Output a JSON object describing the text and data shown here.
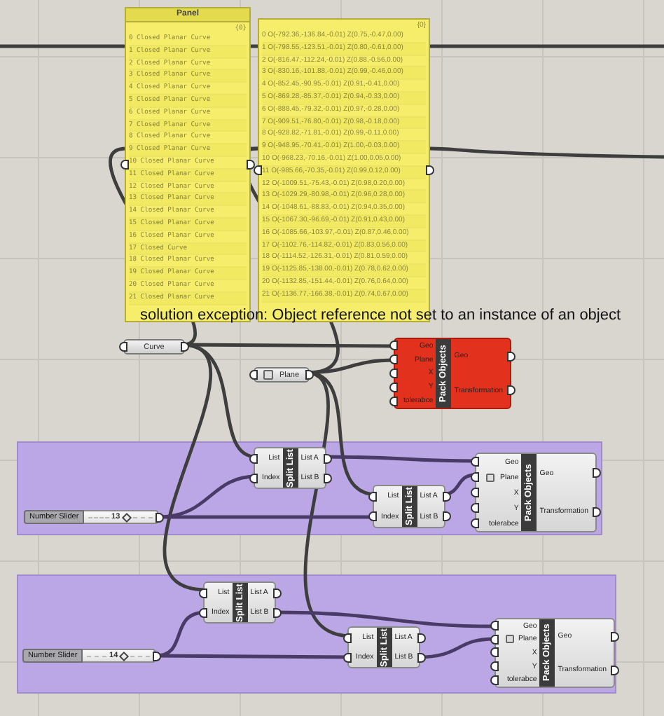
{
  "panels": [
    {
      "title": "Panel",
      "path": "{0}",
      "items": [
        "0 Closed Planar Curve",
        "1 Closed Planar Curve",
        "2 Closed Planar Curve",
        "3 Closed Planar Curve",
        "4 Closed Planar Curve",
        "5 Closed Planar Curve",
        "6 Closed Planar Curve",
        "7 Closed Planar Curve",
        "8 Closed Planar Curve",
        "9 Closed Planar Curve",
        "10 Closed Planar Curve",
        "11 Closed Planar Curve",
        "12 Closed Planar Curve",
        "13 Closed Planar Curve",
        "14 Closed Planar Curve",
        "15 Closed Planar Curve",
        "16 Closed Planar Curve",
        "17 Closed Curve",
        "18 Closed Planar Curve",
        "19 Closed Planar Curve",
        "20 Closed Planar Curve",
        "21 Closed Planar Curve"
      ]
    },
    {
      "path": "{0}",
      "items": [
        "0 O(-792.36,-136.84,-0.01) Z(0.75,-0.47,0.00)",
        "1 O(-798.55,-123.51,-0.01) Z(0.80,-0.61,0.00)",
        "2 O(-816.47,-112.24,-0.01) Z(0.88,-0.56,0.00)",
        "3 O(-830.16,-101.88,-0.01) Z(0.99,-0.46,0.00)",
        "4 O(-852.45,-90.95,-0.01) Z(0.91,-0.41,0.00)",
        "5 O(-869.28,-85.37,-0.01) Z(0.94,-0.33,0.00)",
        "6 O(-888.45,-79.32,-0.01) Z(0.97,-0.28,0.00)",
        "7 O(-909.51,-76.80,-0.01) Z(0.98,-0.18,0.00)",
        "8 O(-928.82,-71.81,-0.01) Z(0.99,-0.11,0.00)",
        "9 O(-948.95,-70.41,-0.01) Z(1.00,-0.03,0.00)",
        "10 O(-968.23,-70.16,-0.01) Z(1.00,0.05,0.00)",
        "11 O(-985.66,-70.35,-0.01) Z(0.99,0.12,0.00)",
        "12 O(-1009.51,-75.43,-0.01) Z(0.98,0.20,0.00)",
        "13 O(-1029.29,-80.98,-0.01) Z(0.96,0.28,0.00)",
        "14 O(-1048.61,-88.83,-0.01) Z(0.94,0.35,0.00)",
        "15 O(-1067.30,-96.69,-0.01) Z(0.91,0.43,0.00)",
        "16 O(-1085.66,-103.97,-0.01) Z(0.87,0.46,0.00)",
        "17 O(-1102.76,-114.82,-0.01) Z(0.83,0.56,0.00)",
        "18 O(-1114.52,-126.31,-0.01) Z(0.81,0.59,0.00)",
        "19 O(-1125.85,-138.00,-0.01) Z(0.78,0.62,0.00)",
        "20 O(-1132.85,-151.44,-0.01) Z(0.76,0.64,0.00)",
        "21 O(-1136.77,-166.38,-0.01) Z(0.74,0.67,0.00)"
      ]
    }
  ],
  "error_message": "solution exception: Object reference not set to an instance of an object",
  "params": [
    {
      "label": "Curve",
      "menu_icon": false
    },
    {
      "label": "Plane",
      "menu_icon": true
    }
  ],
  "components": [
    {
      "title": "Pack Objects",
      "error": true,
      "input_menu": false,
      "inputs": [
        "Geo",
        "Plane",
        "X",
        "Y",
        "tolerabce"
      ],
      "outputs": [
        "Geo",
        "Transformation"
      ]
    }
  ],
  "groups": [
    {
      "slider": {
        "label": "Number Slider",
        "value": "13"
      },
      "components": [
        {
          "title": "Split List",
          "error": false,
          "input_menu": false,
          "inputs": [
            "List",
            "Index"
          ],
          "outputs": [
            "List A",
            "List B"
          ]
        },
        {
          "title": "Split List",
          "error": false,
          "input_menu": false,
          "inputs": [
            "List",
            "Index"
          ],
          "outputs": [
            "List A",
            "List B"
          ]
        },
        {
          "title": "Pack Objects",
          "error": false,
          "input_menu": true,
          "inputs": [
            "Geo",
            "Plane",
            "X",
            "Y",
            "tolerabce"
          ],
          "outputs": [
            "Geo",
            "Transformation"
          ]
        }
      ]
    },
    {
      "slider": {
        "label": "Number Slider",
        "value": "14"
      },
      "components": [
        {
          "title": "Split List",
          "error": false,
          "input_menu": false,
          "inputs": [
            "List",
            "Index"
          ],
          "outputs": [
            "List A",
            "List B"
          ]
        },
        {
          "title": "Split List",
          "error": false,
          "input_menu": false,
          "inputs": [
            "List",
            "Index"
          ],
          "outputs": [
            "List A",
            "List B"
          ]
        },
        {
          "title": "Pack Objects",
          "error": false,
          "input_menu": true,
          "inputs": [
            "Geo",
            "Plane",
            "X",
            "Y",
            "tolerabce"
          ],
          "outputs": [
            "Geo",
            "Transformation"
          ]
        }
      ]
    }
  ]
}
